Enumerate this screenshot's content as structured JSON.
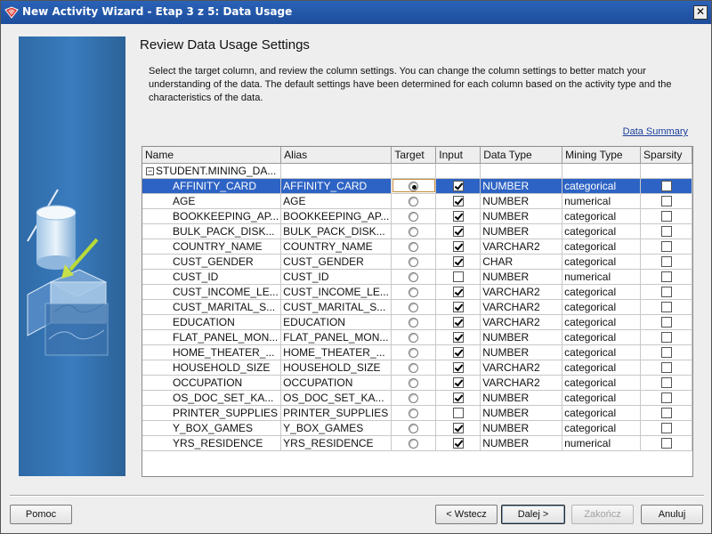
{
  "window": {
    "title": "New Activity Wizard - Etap 3 z 5: Data Usage",
    "close_glyph": "✕"
  },
  "page": {
    "heading": "Review Data Usage Settings",
    "description": "Select the target column, and review the column settings. You can change the column settings to better match your understanding of the data. The default settings have been determined for each column based on the activity type and the characteristics of the data.",
    "summary_link": "Data Summary"
  },
  "grid": {
    "columns": [
      "Name",
      "Alias",
      "Target",
      "Input",
      "Data Type",
      "Mining Type",
      "Sparsity"
    ],
    "root": {
      "expander": "−",
      "label": "STUDENT.MINING_DA..."
    },
    "rows": [
      {
        "name": "AFFINITY_CARD",
        "alias": "AFFINITY_CARD",
        "target": true,
        "input": true,
        "data_type": "NUMBER",
        "mining_type": "categorical",
        "sparsity": false
      },
      {
        "name": "AGE",
        "alias": "AGE",
        "target": false,
        "input": true,
        "data_type": "NUMBER",
        "mining_type": "numerical",
        "sparsity": false
      },
      {
        "name": "BOOKKEEPING_AP...",
        "alias": "BOOKKEEPING_AP...",
        "target": false,
        "input": true,
        "data_type": "NUMBER",
        "mining_type": "categorical",
        "sparsity": false
      },
      {
        "name": "BULK_PACK_DISK...",
        "alias": "BULK_PACK_DISK...",
        "target": false,
        "input": true,
        "data_type": "NUMBER",
        "mining_type": "categorical",
        "sparsity": false
      },
      {
        "name": "COUNTRY_NAME",
        "alias": "COUNTRY_NAME",
        "target": false,
        "input": true,
        "data_type": "VARCHAR2",
        "mining_type": "categorical",
        "sparsity": false
      },
      {
        "name": "CUST_GENDER",
        "alias": "CUST_GENDER",
        "target": false,
        "input": true,
        "data_type": "CHAR",
        "mining_type": "categorical",
        "sparsity": false
      },
      {
        "name": "CUST_ID",
        "alias": "CUST_ID",
        "target": false,
        "input": false,
        "data_type": "NUMBER",
        "mining_type": "numerical",
        "sparsity": false
      },
      {
        "name": "CUST_INCOME_LE...",
        "alias": "CUST_INCOME_LE...",
        "target": false,
        "input": true,
        "data_type": "VARCHAR2",
        "mining_type": "categorical",
        "sparsity": false
      },
      {
        "name": "CUST_MARITAL_S...",
        "alias": "CUST_MARITAL_S...",
        "target": false,
        "input": true,
        "data_type": "VARCHAR2",
        "mining_type": "categorical",
        "sparsity": false
      },
      {
        "name": "EDUCATION",
        "alias": "EDUCATION",
        "target": false,
        "input": true,
        "data_type": "VARCHAR2",
        "mining_type": "categorical",
        "sparsity": false
      },
      {
        "name": "FLAT_PANEL_MON...",
        "alias": "FLAT_PANEL_MON...",
        "target": false,
        "input": true,
        "data_type": "NUMBER",
        "mining_type": "categorical",
        "sparsity": false
      },
      {
        "name": "HOME_THEATER_...",
        "alias": "HOME_THEATER_...",
        "target": false,
        "input": true,
        "data_type": "NUMBER",
        "mining_type": "categorical",
        "sparsity": false
      },
      {
        "name": "HOUSEHOLD_SIZE",
        "alias": "HOUSEHOLD_SIZE",
        "target": false,
        "input": true,
        "data_type": "VARCHAR2",
        "mining_type": "categorical",
        "sparsity": false
      },
      {
        "name": "OCCUPATION",
        "alias": "OCCUPATION",
        "target": false,
        "input": true,
        "data_type": "VARCHAR2",
        "mining_type": "categorical",
        "sparsity": false
      },
      {
        "name": "OS_DOC_SET_KA...",
        "alias": "OS_DOC_SET_KA...",
        "target": false,
        "input": true,
        "data_type": "NUMBER",
        "mining_type": "categorical",
        "sparsity": false
      },
      {
        "name": "PRINTER_SUPPLIES",
        "alias": "PRINTER_SUPPLIES",
        "target": false,
        "input": false,
        "data_type": "NUMBER",
        "mining_type": "categorical",
        "sparsity": false
      },
      {
        "name": "Y_BOX_GAMES",
        "alias": "Y_BOX_GAMES",
        "target": false,
        "input": true,
        "data_type": "NUMBER",
        "mining_type": "categorical",
        "sparsity": false
      },
      {
        "name": "YRS_RESIDENCE",
        "alias": "YRS_RESIDENCE",
        "target": false,
        "input": true,
        "data_type": "NUMBER",
        "mining_type": "numerical",
        "sparsity": false
      }
    ],
    "selected_row": 0
  },
  "buttons": {
    "help": "Pomoc",
    "back": "< Wstecz",
    "next": "Dalej >",
    "finish": "Zakończ",
    "cancel": "Anuluj"
  },
  "colors": {
    "title_bar": "#2a62b8",
    "selection": "#2d63c4",
    "link": "#1a3f9c"
  },
  "icons": [
    "app-icon",
    "close-icon",
    "collapse-icon",
    "wizard-art-icon"
  ]
}
